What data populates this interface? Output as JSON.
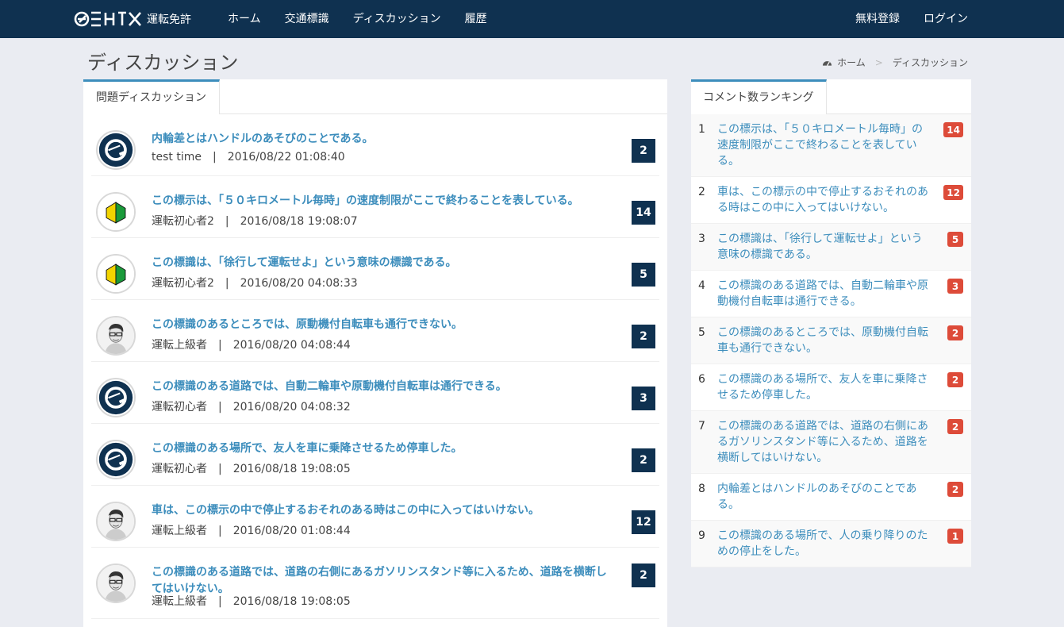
{
  "nav": {
    "brand_text": "運転免許",
    "links": [
      "ホーム",
      "交通標識",
      "ディスカッション",
      "履歴"
    ],
    "right_links": [
      "無料登録",
      "ログイン"
    ]
  },
  "header": {
    "title": "ディスカッション",
    "breadcrumb": [
      "ホーム",
      "ディスカッション"
    ]
  },
  "main": {
    "tab_label": "問題ディスカッション",
    "topics": [
      {
        "title": "内輪差とはハンドルのあそびのことである。",
        "author": "test time",
        "date": "2016/08/22 01:08:40",
        "count": "2",
        "avatar": "e-logo-icon"
      },
      {
        "title": "この標示は、「５０キロメートル毎時」の速度制限がここで終わることを表している。",
        "author": "運転初心者2",
        "date": "2016/08/18 19:08:07",
        "count": "14",
        "avatar": "beginner-mark-icon"
      },
      {
        "title": "この標識は、「徐行して運転せよ」という意味の標識である。",
        "author": "運転初心者2",
        "date": "2016/08/20 04:08:33",
        "count": "5",
        "avatar": "beginner-mark-icon"
      },
      {
        "title": "この標識のあるところでは、原動機付自転車も通行できない。",
        "author": "運転上級者",
        "date": "2016/08/20 04:08:44",
        "count": "2",
        "avatar": "man-portrait-icon"
      },
      {
        "title": "この標識のある道路では、自動二輪車や原動機付自転車は通行できる。",
        "author": "運転初心者",
        "date": "2016/08/20 04:08:32",
        "count": "3",
        "avatar": "e-logo-icon"
      },
      {
        "title": "この標識のある場所で、友人を車に乗降させるため停車した。",
        "author": "運転初心者",
        "date": "2016/08/18 19:08:05",
        "count": "2",
        "avatar": "e-logo-icon"
      },
      {
        "title": "車は、この標示の中で停止するおそれのある時はこの中に入ってはいけない。",
        "author": "運転上級者",
        "date": "2016/08/20 01:08:44",
        "count": "12",
        "avatar": "man-portrait-icon"
      },
      {
        "title": "この標識のある道路では、道路の右側にあるガソリンスタンド等に入るため、道路を横断してはいけない。",
        "author": "運転上級者",
        "date": "2016/08/18 19:08:05",
        "count": "2",
        "avatar": "man-portrait-icon"
      }
    ]
  },
  "sidebar": {
    "tab_label": "コメント数ランキング",
    "ranking": [
      {
        "rank": "1",
        "text": "この標示は、「５０キロメートル毎時」の速度制限がここで終わることを表している。",
        "count": "14"
      },
      {
        "rank": "2",
        "text": "車は、この標示の中で停止するおそれのある時はこの中に入ってはいけない。",
        "count": "12"
      },
      {
        "rank": "3",
        "text": "この標識は、「徐行して運転せよ」という意味の標識である。",
        "count": "5"
      },
      {
        "rank": "4",
        "text": "この標識のある道路では、自動二輪車や原動機付自転車は通行できる。",
        "count": "3"
      },
      {
        "rank": "5",
        "text": "この標識のあるところでは、原動機付自転車も通行できない。",
        "count": "2"
      },
      {
        "rank": "6",
        "text": "この標識のある場所で、友人を車に乗降させるため停車した。",
        "count": "2"
      },
      {
        "rank": "7",
        "text": "この標識のある道路では、道路の右側にあるガソリンスタンド等に入るため、道路を横断してはいけない。",
        "count": "2"
      },
      {
        "rank": "8",
        "text": "内輪差とはハンドルのあそびのことである。",
        "count": "2"
      },
      {
        "rank": "9",
        "text": "この標識のある場所で、人の乗り降りのための停止をした。",
        "count": "1"
      }
    ]
  },
  "colors": {
    "navbar": "#0f3150",
    "link": "#3c8dbc",
    "badge_dark": "#0f3150",
    "badge_red": "#dd4b39"
  }
}
